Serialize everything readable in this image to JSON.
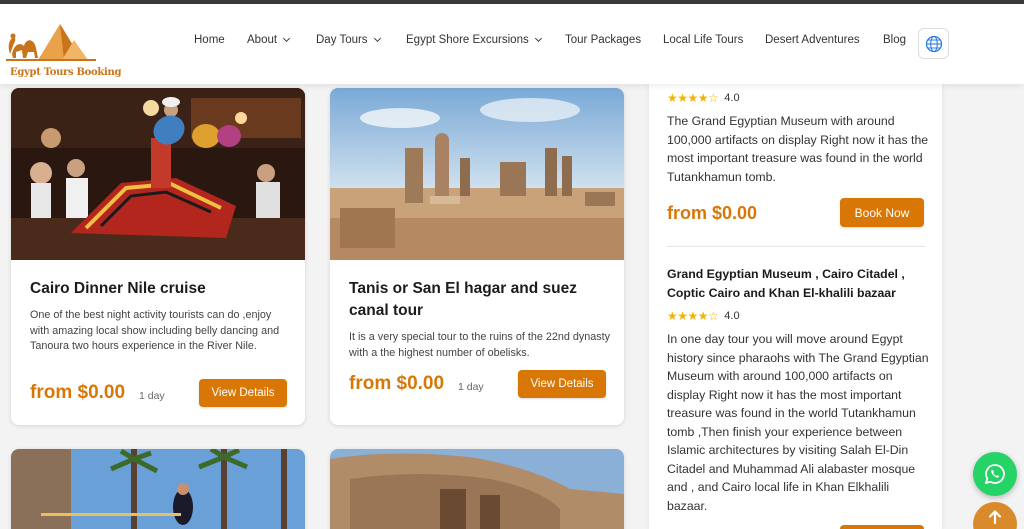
{
  "brand": {
    "logo_text": "Egypt Tours Booking"
  },
  "nav": {
    "items": [
      {
        "label": "Home",
        "dropdown": false
      },
      {
        "label": "About",
        "dropdown": true
      },
      {
        "label": "Day Tours",
        "dropdown": true
      },
      {
        "label": "Egypt Shore Excursions",
        "dropdown": true
      },
      {
        "label": "Tour Packages",
        "dropdown": false
      },
      {
        "label": "Local Life Tours",
        "dropdown": false
      },
      {
        "label": "Desert Adventures",
        "dropdown": false
      },
      {
        "label": "Blog",
        "dropdown": false
      }
    ],
    "language_icon": "globe-icon"
  },
  "cards": [
    {
      "title": "Cairo Dinner Nile cruise",
      "description": "One of the best night activity tourists can do ,enjoy with amazing local show including belly dancing and Tanoura two hours experience in the River Nile.",
      "price": "from $0.00",
      "duration": "1 day",
      "button": "View Details"
    },
    {
      "title": "Tanis or San El hagar and suez canal tour",
      "description": "It is a very special tour to the ruins of the 22nd dynasty with a the highest number of obelisks.",
      "price": "from $0.00",
      "duration": "1 day",
      "button": "View Details"
    }
  ],
  "sidebar": {
    "tours": [
      {
        "rating": "4.0",
        "stars": 4,
        "description": "The Grand Egyptian Museum with around 100,000 artifacts on display Right now it has the most important treasure was found in the world Tutankhamun tomb.",
        "price": "from $0.00",
        "button": "Book Now"
      },
      {
        "title": "Grand Egyptian Museum , Cairo Citadel , Coptic Cairo and Khan El-khalili bazaar",
        "rating": "4.0",
        "stars": 4,
        "description": "In one day tour you will move around Egypt history since pharaohs with The Grand Egyptian Museum with around 100,000 artifacts on display Right now it has the most important treasure was found in the world Tutankhamun tomb ,Then finish your experience between Islamic architectures by visiting Salah El-Din Citadel and Muhammad Ali alabaster mosque and , and Cairo local life in Khan Elkhalili bazaar."
      }
    ]
  },
  "floating": {
    "whatsapp_icon": "whatsapp-icon",
    "scroll_top_icon": "arrow-up-icon"
  },
  "colors": {
    "accent": "#d97706",
    "whatsapp": "#25d366"
  }
}
